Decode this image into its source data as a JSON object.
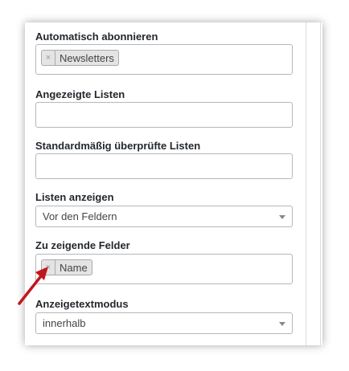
{
  "fields": {
    "auto_subscribe": {
      "label": "Automatisch abonnieren",
      "tag": "Newsletters",
      "remove": "×"
    },
    "shown_lists": {
      "label": "Angezeigte Listen"
    },
    "default_checked": {
      "label": "Standardmäßig überprüfte Listen"
    },
    "show_lists": {
      "label": "Listen anzeigen",
      "value": "Vor den Feldern"
    },
    "fields_to_show": {
      "label": "Zu zeigende Felder",
      "tag": "Name",
      "remove": "×"
    },
    "label_mode": {
      "label": "Anzeigetextmodus",
      "value": "innerhalb"
    }
  },
  "colors": {
    "arrow": "#c0171e",
    "label": "#23282d",
    "border": "#b7b7b7"
  },
  "icons": {
    "annotation": "red-arrow-icon",
    "dropdown": "chevron-down-icon",
    "remove": "close-icon"
  }
}
